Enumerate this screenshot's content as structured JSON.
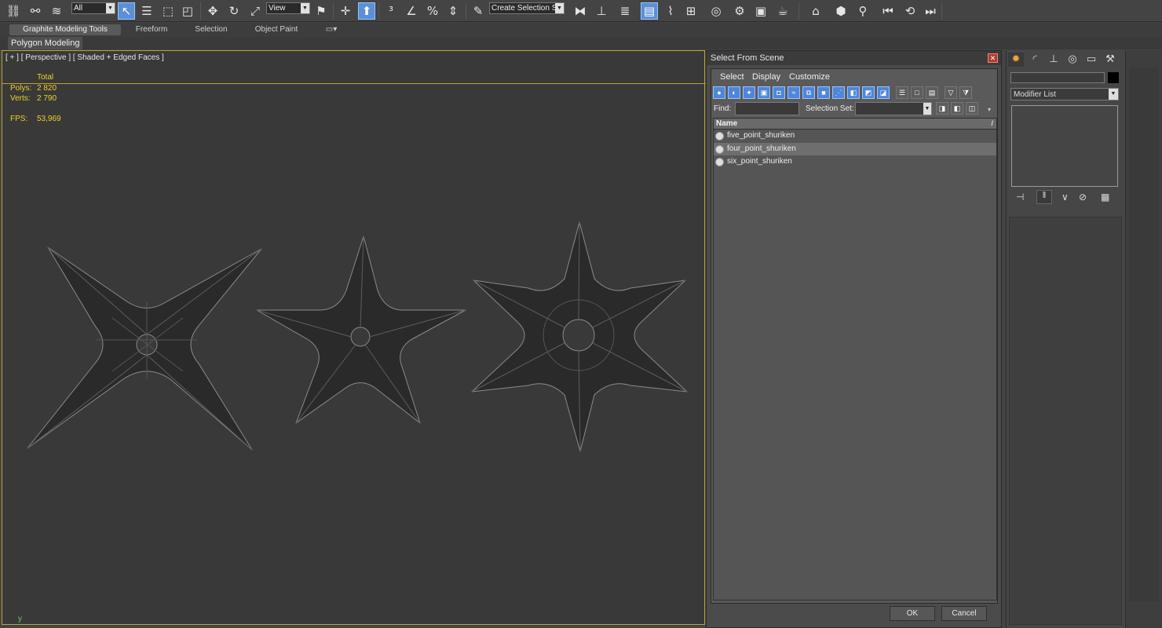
{
  "toolbar": {
    "selection_filter": "All",
    "ref_coord": "View",
    "selection_set": "Create Selection Se",
    "icons": [
      "link-icon",
      "unlink-icon",
      "bind-space-warp-icon",
      "select-object-icon",
      "select-by-name-icon",
      "rect-region-icon",
      "window-crossing-icon",
      "move-icon",
      "rotate-icon",
      "scale-icon",
      "pivot-icon",
      "manipulate-icon",
      "snaps-icon",
      "angle-snap-icon",
      "percent-snap-icon",
      "spinner-snap-icon",
      "edit-named-sel-icon",
      "mirror-icon",
      "align-icon",
      "layer-icon",
      "scene-explorer-icon",
      "curve-editor-icon",
      "schematic-icon",
      "material-editor-icon",
      "render-setup-icon",
      "rendered-frame-icon",
      "render-icon"
    ]
  },
  "ribbon": {
    "tabs": [
      "Graphite Modeling Tools",
      "Freeform",
      "Selection",
      "Object Paint"
    ],
    "active_tab": "Graphite Modeling Tools",
    "sub_tab": "Polygon Modeling"
  },
  "viewport": {
    "label": "[ + ] [ Perspective ] [ Shaded + Edged Faces ]",
    "stats": {
      "total_label": "Total",
      "polys_label": "Polys:",
      "polys_value": "2 820",
      "verts_label": "Verts:",
      "verts_value": "2 790",
      "fps_label": "FPS:",
      "fps_value": "53,969"
    },
    "axis_label": "y"
  },
  "dialog": {
    "title": "Select From Scene",
    "close": "✕",
    "menu": [
      "Select",
      "Display",
      "Customize"
    ],
    "find_label": "Find:",
    "selection_set_label": "Selection Set:",
    "column_header": "Name",
    "objects": [
      {
        "name": "five_point_shuriken",
        "selected": false
      },
      {
        "name": "four_point_shuriken",
        "selected": true
      },
      {
        "name": "six_point_shuriken",
        "selected": false
      }
    ],
    "ok": "OK",
    "cancel": "Cancel"
  },
  "command_panel": {
    "modifier_list": "Modifier List",
    "tabs": [
      "create-icon",
      "modify-icon",
      "hierarchy-icon",
      "motion-icon",
      "display-icon",
      "utilities-icon"
    ]
  }
}
